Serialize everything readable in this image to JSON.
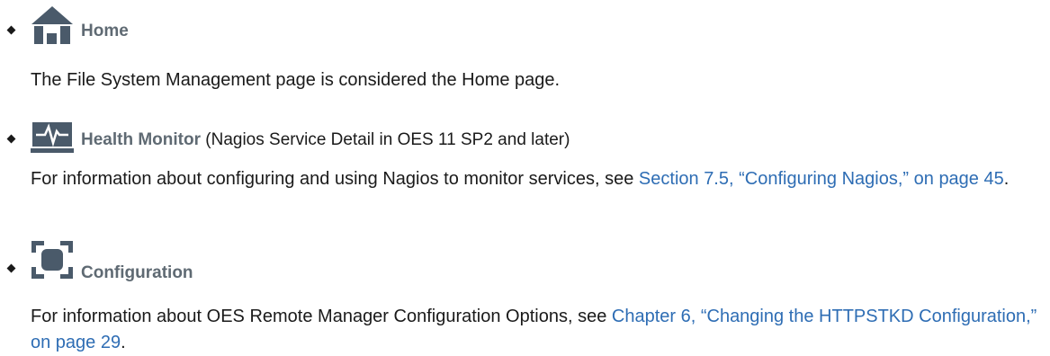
{
  "items": [
    {
      "icon": "home-icon",
      "label": "Home",
      "label_suffix": "",
      "description": "The File System Management page is considered the Home page."
    },
    {
      "icon": "health-monitor-icon",
      "label": "Health Monitor",
      "label_suffix": " (Nagios Service Detail in OES 11 SP2 and later)",
      "description_before": "For information about configuring and using Nagios to monitor services, see ",
      "link_text": "Section 7.5, “Configuring Nagios,” on page 45",
      "description_after": "."
    },
    {
      "icon": "configuration-icon",
      "label": "Configuration",
      "label_suffix": "",
      "description_before": "For information about OES Remote Manager Configuration Options, see ",
      "link_text": "Chapter 6, “Changing the HTTPSTKD Configuration,” on page 29",
      "description_after": "."
    }
  ],
  "colors": {
    "icon_fill": "#4a5a6a",
    "label": "#5f6a73",
    "link": "#2e6db4",
    "text": "#1a1a1a"
  }
}
